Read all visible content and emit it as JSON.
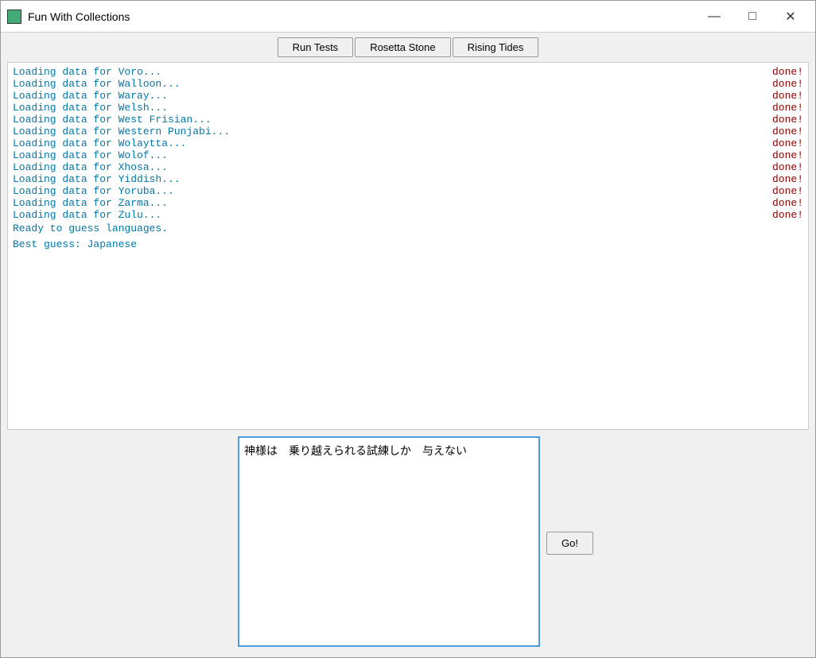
{
  "window": {
    "title": "Fun With Collections",
    "icon_label": "app-icon"
  },
  "title_controls": {
    "minimize": "—",
    "maximize": "□",
    "close": "✕"
  },
  "toolbar": {
    "run_tests": "Run Tests",
    "rosetta_stone": "Rosetta Stone",
    "rising_tides": "Rising Tides"
  },
  "log": {
    "lines": [
      {
        "text": "Loading data for Voro...",
        "status": "done!"
      },
      {
        "text": "Loading data for Walloon...",
        "status": "done!"
      },
      {
        "text": "Loading data for Waray...",
        "status": "done!"
      },
      {
        "text": "Loading data for Welsh...",
        "status": "done!"
      },
      {
        "text": "Loading data for West Frisian...",
        "status": "done!"
      },
      {
        "text": "Loading data for Western Punjabi...",
        "status": "done!"
      },
      {
        "text": "Loading data for Wolaytta...",
        "status": "done!"
      },
      {
        "text": "Loading data for Wolof...",
        "status": "done!"
      },
      {
        "text": "Loading data for Xhosa...",
        "status": "done!"
      },
      {
        "text": "Loading data for Yiddish...",
        "status": "done!"
      },
      {
        "text": "Loading data for Yoruba...",
        "status": "done!"
      },
      {
        "text": "Loading data for Zarma...",
        "status": "done!"
      },
      {
        "text": "Loading data for Zulu...",
        "status": "done!"
      }
    ],
    "ready_line": "Ready to guess languages.",
    "guess_line": "Best guess: Japanese"
  },
  "input": {
    "value": "神様は　乗り越えられる試練しか　与えない",
    "placeholder": ""
  },
  "go_button": {
    "label": "Go!"
  }
}
